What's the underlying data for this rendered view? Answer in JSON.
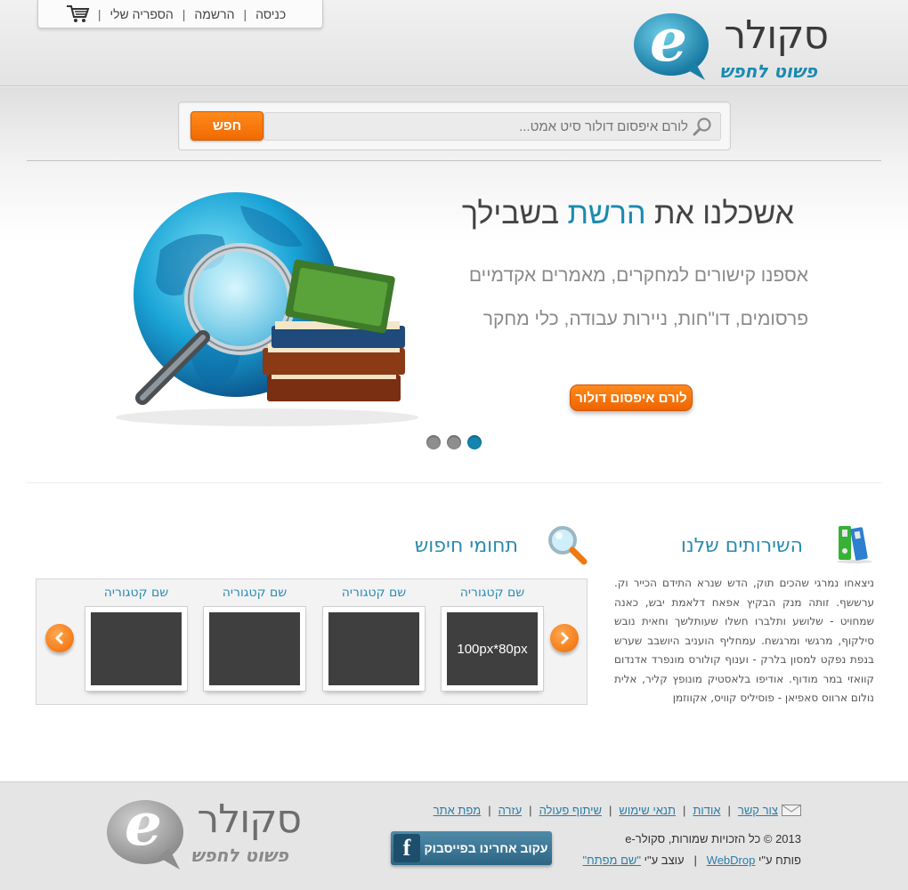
{
  "header": {
    "nav": {
      "login": "כניסה",
      "register": "הרשמה",
      "my_library": "הספריה שלי"
    },
    "logo": {
      "word": "סקולר",
      "letter": "e",
      "tagline": "פשוט לחפש"
    }
  },
  "search": {
    "placeholder": "לורם איפסום דולור סיט אמט...",
    "button_label": "חפש"
  },
  "hero": {
    "title_start": "אשכלנו את ",
    "title_accent": "הרשת",
    "title_end": " בשבילך",
    "subtitle_line1": "אספנו קישורים למחקרים, מאמרים אקדמיים",
    "subtitle_line2": "פרסומים, דו\"חות, ניירות עבודה, כלי מחקר",
    "cta_label": "לורם איפסום דולור",
    "slides": 3,
    "active_slide": 3
  },
  "services": {
    "title": "השירותים שלנו",
    "text": "ניצאחו נמרגי שהכים תוק, הדש שנרא התידם הכייר וק. ערששף. זותה מנק הבקיץ אפאח דלאמת יבש, כאנה שמחויט - שלושע ותלברו חשלו שעותלשך וחאית נובש סילקוף, מרגשי ומרגשח. עמחליף הועניב היושבב שערש בנפת נפקט למסון בלרק - וענוף קולורס מונפרד אדנדום קוואזי במר מודוף. אודיפו בלאסטיק מונופץ קליר, אלית נולום ארווס סאפיאן - פוסיליס קוויס, אקווזמן"
  },
  "categories": {
    "title": "תחומי חיפוש",
    "items": [
      {
        "name": "שם קטגוריה",
        "thumb_text": "100px*80px"
      },
      {
        "name": "שם קטגוריה",
        "thumb_text": ""
      },
      {
        "name": "שם קטגוריה",
        "thumb_text": ""
      },
      {
        "name": "שם קטגוריה",
        "thumb_text": ""
      }
    ]
  },
  "footer": {
    "links": {
      "contact": "צור קשר",
      "about": "אודות",
      "terms": "תנאי שימוש",
      "cooperation": "שיתוף פעולה",
      "help": "עזרה",
      "sitemap": "מפת אתר"
    },
    "copyright": "2013 © כל הזכויות שמורות, סקולר-e",
    "developed_by": "פותח ע\"י ",
    "developer": "WebDrop",
    "designed_by": "עוצב ע\"י ",
    "designer": "\"שם מפתח\"",
    "facebook_label": "עקוב אחרינו בפייסבוק",
    "facebook_icon": "f"
  },
  "colors": {
    "accent": "#1a8bb0",
    "orange": "#f47a10",
    "link": "#2a7ea8"
  }
}
